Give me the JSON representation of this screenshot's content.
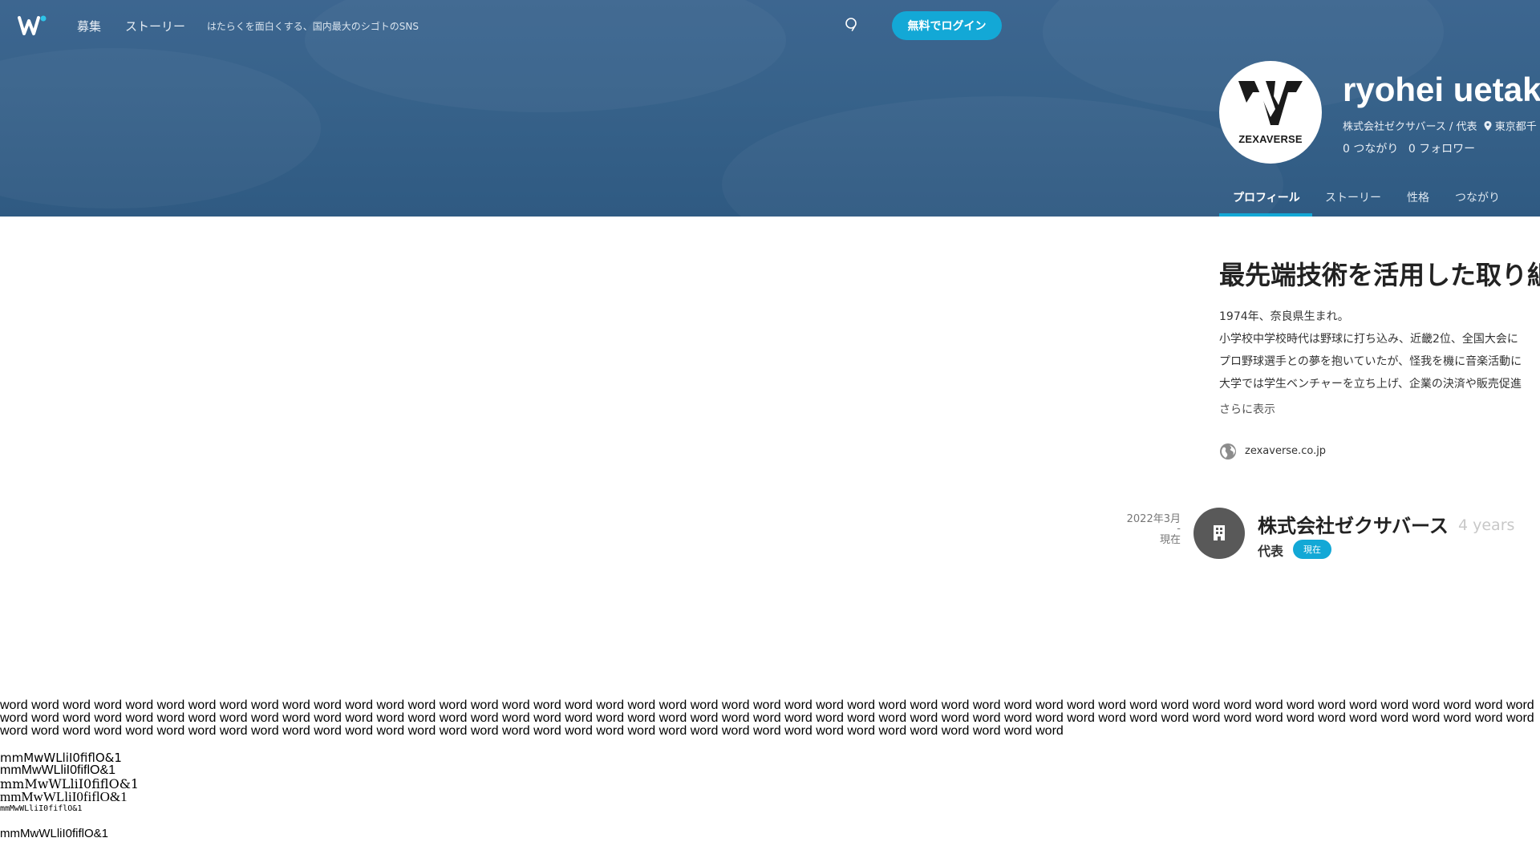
{
  "nav": {
    "links": [
      "募集",
      "ストーリー"
    ],
    "tagline": "はたらくを面白くする、国内最大のシゴトのSNS",
    "login_label": "無料でログイン"
  },
  "profile": {
    "name": "ryohei uetak",
    "logo_text": "ZEXAVERSE",
    "subtitle": "株式会社ゼクサバース / 代表",
    "location": "東京都千",
    "connections": "0 つながり",
    "followers": "0 フォロワー",
    "tabs": [
      "プロフィール",
      "ストーリー",
      "性格",
      "つながり"
    ],
    "active_tab": "プロフィール"
  },
  "about": {
    "headline": "最先端技術を活用した取り組",
    "bio": [
      "1974年、奈良県生まれ。",
      "小学校中学校時代は野球に打ち込み、近畿2位、全国大会に",
      "プロ野球選手との夢を抱いていたが、怪我を機に音楽活動に",
      "大学では学生ベンチャーを立ち上げ、企業の決済や販売促進"
    ],
    "show_more": "さらに表示",
    "website": "zexaverse.co.jp"
  },
  "career": {
    "date_start": "2022年3月",
    "date_sep": "-",
    "date_end": "現在",
    "company": "株式会社ゼクサバース",
    "duration": "4 years",
    "role": "代表",
    "badge": "現在"
  },
  "test_text": {
    "words": "word word word word word word word word word word word word word word word word word word word word word word word word word word word word word word word word word word word word word word word word word word word word word word word word word word word word word word word word word word word word word word word word word word word word word word word word word word word word word word word word word word word word word word word word word word word word word word word word word word word word word word word word word word word word word word word word word word word word word word word word word word word word word word word word word word word word",
    "font_samples": [
      "mmMwWLliI0fiflO&1",
      "mmMwWLliI0fiflO&1",
      "mmMwWLliI0fiflO&1",
      "mmMwWLliI0fiflO&1",
      "mmMwWLliI0fiflO&1",
      "mmMwWLliI0fiflO&1"
    ]
  },
  "colors": {
    "hero": "#37628a",
    "accent": "#13a8d6"
  }
}
